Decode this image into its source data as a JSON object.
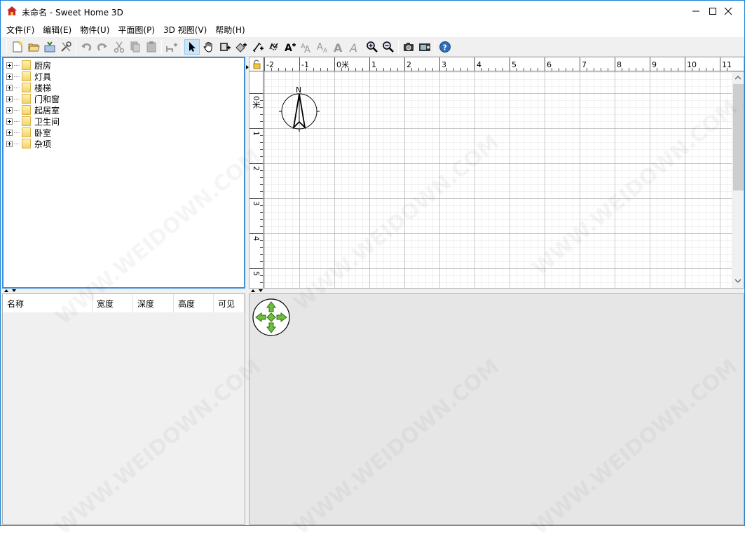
{
  "window": {
    "title": "未命名 - Sweet Home 3D",
    "controls": [
      "minimize",
      "maximize",
      "close"
    ]
  },
  "menu": [
    "文件(F)",
    "编辑(E)",
    "物件(U)",
    "平面图(P)",
    "3D 视图(V)",
    "帮助(H)"
  ],
  "toolbar": {
    "buttons": [
      "new-home-icon",
      "open-icon",
      "save-icon",
      "preferences-icon",
      "undo-icon",
      "redo-icon",
      "cut-icon",
      "copy-icon",
      "paste-icon",
      "add-furniture-icon",
      "select-mode-icon",
      "pan-mode-icon",
      "create-walls-icon",
      "create-rooms-icon",
      "create-dimensions-icon",
      "create-polylines-icon",
      "add-text-icon",
      "increase-text-size-icon",
      "decrease-text-size-icon",
      "bold-icon",
      "italic-icon",
      "zoom-in-icon",
      "zoom-out-icon",
      "create-photo-icon",
      "create-video-icon",
      "help-icon"
    ],
    "active_button": "select-mode-icon"
  },
  "catalog": {
    "categories": [
      "厨房",
      "灯具",
      "楼梯",
      "门和窗",
      "起居室",
      "卫生间",
      "卧室",
      "杂项"
    ]
  },
  "furniture_table": {
    "columns": [
      "名称",
      "宽度",
      "深度",
      "高度",
      "可见"
    ]
  },
  "plan": {
    "x_ruler": [
      "-2",
      "-1",
      "0米",
      "1",
      "2",
      "3",
      "4",
      "5",
      "6",
      "7",
      "8",
      "9",
      "10",
      "11"
    ],
    "y_ruler": [
      "0米",
      "1",
      "2",
      "3",
      "4",
      "5"
    ],
    "compass_label": "N"
  },
  "watermark": "WWW.WEIDOWN.COM",
  "colors": {
    "accent": "#1883d7",
    "selection_border": "#3c8fd8",
    "grid_minor": "#e4e4e4",
    "grid_major": "#a8a8a8",
    "navigator_green": "#6fbf3a"
  }
}
